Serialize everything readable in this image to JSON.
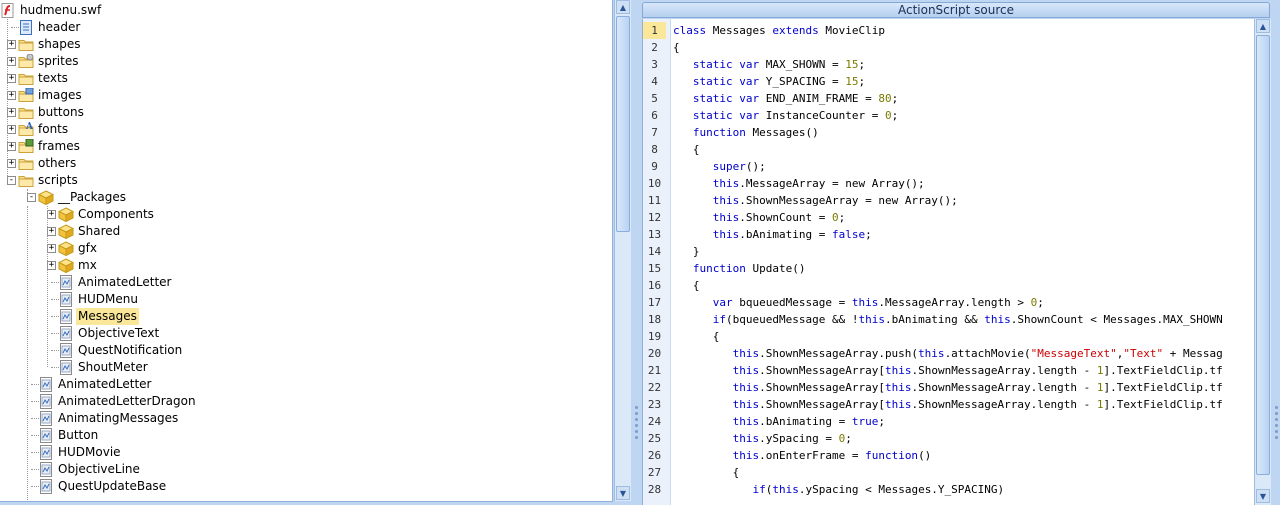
{
  "tree": {
    "root": {
      "label": "hudmenu.swf",
      "icon": "flash-file-icon"
    },
    "items": [
      {
        "label": "header",
        "icon": "document-icon",
        "toggle": ""
      },
      {
        "label": "shapes",
        "icon": "folder-shapes-icon",
        "toggle": "+"
      },
      {
        "label": "sprites",
        "icon": "folder-sprites-icon",
        "toggle": "+"
      },
      {
        "label": "texts",
        "icon": "folder-texts-icon",
        "toggle": "+"
      },
      {
        "label": "images",
        "icon": "folder-images-icon",
        "toggle": "+"
      },
      {
        "label": "buttons",
        "icon": "folder-buttons-icon",
        "toggle": "+"
      },
      {
        "label": "fonts",
        "icon": "folder-fonts-icon",
        "toggle": "+"
      },
      {
        "label": "frames",
        "icon": "folder-frames-icon",
        "toggle": "+"
      },
      {
        "label": "others",
        "icon": "folder-others-icon",
        "toggle": "+"
      },
      {
        "label": "scripts",
        "icon": "folder-scripts-icon",
        "toggle": "-"
      }
    ],
    "packages": {
      "label": "__Packages",
      "icon": "package-icon",
      "toggle": "-"
    },
    "package_children": [
      {
        "label": "Components",
        "icon": "package-icon",
        "toggle": "+"
      },
      {
        "label": "Shared",
        "icon": "package-icon",
        "toggle": "+"
      },
      {
        "label": "gfx",
        "icon": "package-icon",
        "toggle": "+"
      },
      {
        "label": "mx",
        "icon": "package-icon",
        "toggle": "+"
      },
      {
        "label": "AnimatedLetter",
        "icon": "script-icon",
        "toggle": ""
      },
      {
        "label": "HUDMenu",
        "icon": "script-icon",
        "toggle": ""
      },
      {
        "label": "Messages",
        "icon": "script-icon",
        "toggle": "",
        "selected": true
      },
      {
        "label": "ObjectiveText",
        "icon": "script-icon",
        "toggle": ""
      },
      {
        "label": "QuestNotification",
        "icon": "script-icon",
        "toggle": ""
      },
      {
        "label": "ShoutMeter",
        "icon": "script-icon",
        "toggle": ""
      }
    ],
    "script_items": [
      {
        "label": "AnimatedLetter",
        "icon": "script-icon"
      },
      {
        "label": "AnimatedLetterDragon",
        "icon": "script-icon"
      },
      {
        "label": "AnimatingMessages",
        "icon": "script-icon"
      },
      {
        "label": "Button",
        "icon": "script-icon"
      },
      {
        "label": "HUDMovie",
        "icon": "script-icon"
      },
      {
        "label": "ObjectiveLine",
        "icon": "script-icon"
      },
      {
        "label": "QuestUpdateBase",
        "icon": "script-icon"
      }
    ]
  },
  "source": {
    "title": "ActionScript source",
    "current_line": 1,
    "lines": [
      [
        [
          "kw",
          "class"
        ],
        [
          "t",
          " Messages "
        ],
        [
          "kw",
          "extends"
        ],
        [
          "t",
          " MovieClip"
        ]
      ],
      [
        [
          "t",
          "{"
        ]
      ],
      [
        [
          "t",
          "   "
        ],
        [
          "kw",
          "static"
        ],
        [
          "t",
          " "
        ],
        [
          "kw",
          "var"
        ],
        [
          "t",
          " MAX_SHOWN = "
        ],
        [
          "num",
          "15"
        ],
        [
          "t",
          ";"
        ]
      ],
      [
        [
          "t",
          "   "
        ],
        [
          "kw",
          "static"
        ],
        [
          "t",
          " "
        ],
        [
          "kw",
          "var"
        ],
        [
          "t",
          " Y_SPACING = "
        ],
        [
          "num",
          "15"
        ],
        [
          "t",
          ";"
        ]
      ],
      [
        [
          "t",
          "   "
        ],
        [
          "kw",
          "static"
        ],
        [
          "t",
          " "
        ],
        [
          "kw",
          "var"
        ],
        [
          "t",
          " END_ANIM_FRAME = "
        ],
        [
          "num",
          "80"
        ],
        [
          "t",
          ";"
        ]
      ],
      [
        [
          "t",
          "   "
        ],
        [
          "kw",
          "static"
        ],
        [
          "t",
          " "
        ],
        [
          "kw",
          "var"
        ],
        [
          "t",
          " InstanceCounter = "
        ],
        [
          "num",
          "0"
        ],
        [
          "t",
          ";"
        ]
      ],
      [
        [
          "t",
          "   "
        ],
        [
          "kw",
          "function"
        ],
        [
          "t",
          " Messages()"
        ]
      ],
      [
        [
          "t",
          "   {"
        ]
      ],
      [
        [
          "t",
          "      "
        ],
        [
          "kw",
          "super"
        ],
        [
          "t",
          "();"
        ]
      ],
      [
        [
          "t",
          "      "
        ],
        [
          "kw",
          "this"
        ],
        [
          "t",
          ".MessageArray = new Array();"
        ]
      ],
      [
        [
          "t",
          "      "
        ],
        [
          "kw",
          "this"
        ],
        [
          "t",
          ".ShownMessageArray = new Array();"
        ]
      ],
      [
        [
          "t",
          "      "
        ],
        [
          "kw",
          "this"
        ],
        [
          "t",
          ".ShownCount = "
        ],
        [
          "num",
          "0"
        ],
        [
          "t",
          ";"
        ]
      ],
      [
        [
          "t",
          "      "
        ],
        [
          "kw",
          "this"
        ],
        [
          "t",
          ".bAnimating = "
        ],
        [
          "kw",
          "false"
        ],
        [
          "t",
          ";"
        ]
      ],
      [
        [
          "t",
          "   }"
        ]
      ],
      [
        [
          "t",
          "   "
        ],
        [
          "kw",
          "function"
        ],
        [
          "t",
          " Update()"
        ]
      ],
      [
        [
          "t",
          "   {"
        ]
      ],
      [
        [
          "t",
          "      "
        ],
        [
          "kw",
          "var"
        ],
        [
          "t",
          " bqueuedMessage = "
        ],
        [
          "kw",
          "this"
        ],
        [
          "t",
          ".MessageArray.length > "
        ],
        [
          "num",
          "0"
        ],
        [
          "t",
          ";"
        ]
      ],
      [
        [
          "t",
          "      "
        ],
        [
          "kw",
          "if"
        ],
        [
          "t",
          "(bqueuedMessage && !"
        ],
        [
          "kw",
          "this"
        ],
        [
          "t",
          ".bAnimating && "
        ],
        [
          "kw",
          "this"
        ],
        [
          "t",
          ".ShownCount < Messages.MAX_SHOWN"
        ]
      ],
      [
        [
          "t",
          "      {"
        ]
      ],
      [
        [
          "t",
          "         "
        ],
        [
          "kw",
          "this"
        ],
        [
          "t",
          ".ShownMessageArray.push("
        ],
        [
          "kw",
          "this"
        ],
        [
          "t",
          ".attachMovie("
        ],
        [
          "str",
          "\"MessageText\""
        ],
        [
          "t",
          ","
        ],
        [
          "str",
          "\"Text\""
        ],
        [
          "t",
          " + Messag"
        ]
      ],
      [
        [
          "t",
          "         "
        ],
        [
          "kw",
          "this"
        ],
        [
          "t",
          ".ShownMessageArray["
        ],
        [
          "kw",
          "this"
        ],
        [
          "t",
          ".ShownMessageArray.length - "
        ],
        [
          "num",
          "1"
        ],
        [
          "t",
          "].TextFieldClip.tf"
        ]
      ],
      [
        [
          "t",
          "         "
        ],
        [
          "kw",
          "this"
        ],
        [
          "t",
          ".ShownMessageArray["
        ],
        [
          "kw",
          "this"
        ],
        [
          "t",
          ".ShownMessageArray.length - "
        ],
        [
          "num",
          "1"
        ],
        [
          "t",
          "].TextFieldClip.tf"
        ]
      ],
      [
        [
          "t",
          "         "
        ],
        [
          "kw",
          "this"
        ],
        [
          "t",
          ".ShownMessageArray["
        ],
        [
          "kw",
          "this"
        ],
        [
          "t",
          ".ShownMessageArray.length - "
        ],
        [
          "num",
          "1"
        ],
        [
          "t",
          "].TextFieldClip.tf"
        ]
      ],
      [
        [
          "t",
          "         "
        ],
        [
          "kw",
          "this"
        ],
        [
          "t",
          ".bAnimating = "
        ],
        [
          "kw",
          "true"
        ],
        [
          "t",
          ";"
        ]
      ],
      [
        [
          "t",
          "         "
        ],
        [
          "kw",
          "this"
        ],
        [
          "t",
          ".ySpacing = "
        ],
        [
          "num",
          "0"
        ],
        [
          "t",
          ";"
        ]
      ],
      [
        [
          "t",
          "         "
        ],
        [
          "kw",
          "this"
        ],
        [
          "t",
          ".onEnterFrame = "
        ],
        [
          "kw",
          "function"
        ],
        [
          "t",
          "()"
        ]
      ],
      [
        [
          "t",
          "         {"
        ]
      ],
      [
        [
          "t",
          "            "
        ],
        [
          "kw",
          "if"
        ],
        [
          "t",
          "("
        ],
        [
          "kw",
          "this"
        ],
        [
          "t",
          ".ySpacing < Messages.Y_SPACING)"
        ]
      ]
    ]
  }
}
